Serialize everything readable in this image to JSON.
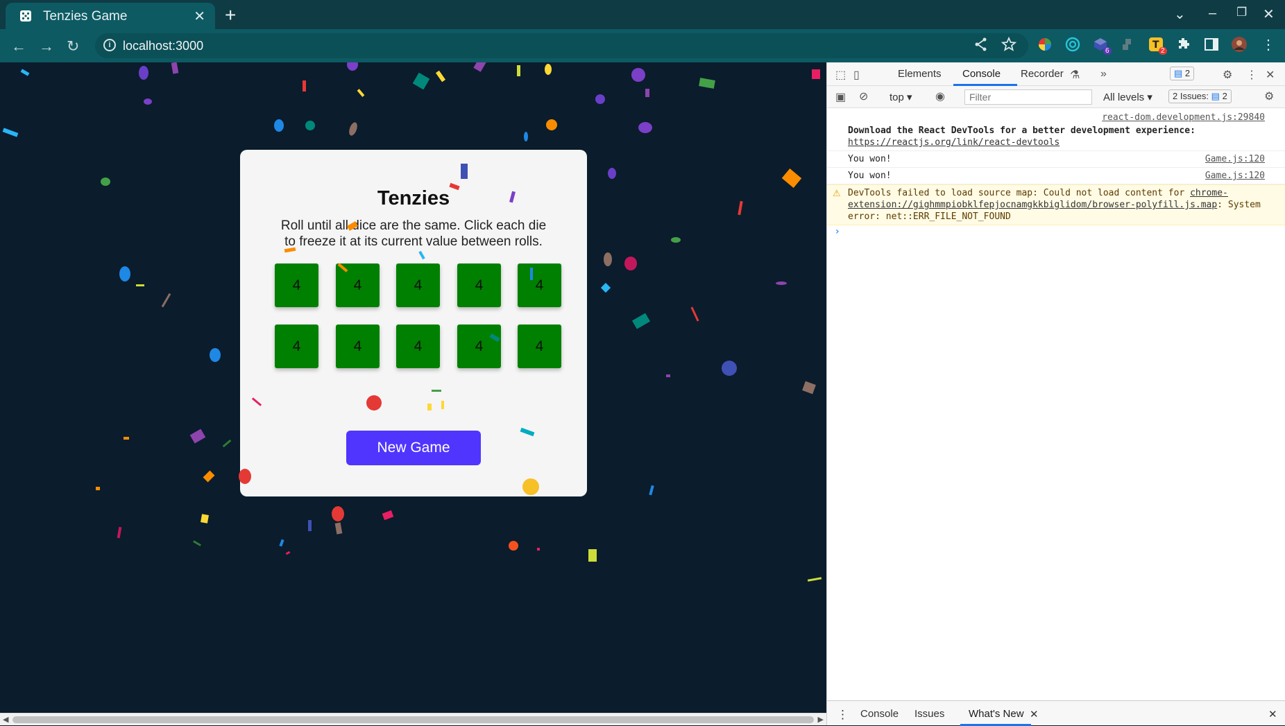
{
  "browser": {
    "tab_title": "Tenzies Game",
    "tab_close": "✕",
    "new_tab": "+",
    "url": "localhost:3000",
    "extension_badge_t": "2",
    "extension_badge_cube": "6"
  },
  "game": {
    "title": "Tenzies",
    "instructions": "Roll until all dice are the same. Click each die to freeze it at its current value between rolls.",
    "dice": [
      "4",
      "4",
      "4",
      "4",
      "4",
      "4",
      "4",
      "4",
      "4",
      "4"
    ],
    "dice_color": "#008000",
    "new_game_label": "New Game",
    "button_color": "#5035ff"
  },
  "devtools": {
    "tabs": [
      "Elements",
      "Console",
      "Recorder"
    ],
    "active_tab": "Console",
    "message_badge": "2",
    "context": "top",
    "filter_placeholder": "Filter",
    "levels": "All levels",
    "issues_label": "2 Issues:",
    "issues_count": "2",
    "messages": [
      {
        "source": "react-dom.development.js:29840",
        "text_bold": "Download the React DevTools for a better development experience: ",
        "link": "https://reactjs.org/link/react-devtools"
      },
      {
        "source": "Game.js:120",
        "text": "You won!"
      },
      {
        "source": "Game.js:120",
        "text": "You won!"
      },
      {
        "level": "warning",
        "text": "DevTools failed to load source map: Could not load content for ",
        "link": "chrome-extension://gighmmpiobklfepjocnamgkkbiglidom/browser-polyfill.js.map",
        "text_after": ": System error: net::ERR_FILE_NOT_FOUND"
      }
    ],
    "drawer_tabs": [
      "Console",
      "Issues",
      "What's New"
    ],
    "active_drawer_tab": "What's New"
  }
}
